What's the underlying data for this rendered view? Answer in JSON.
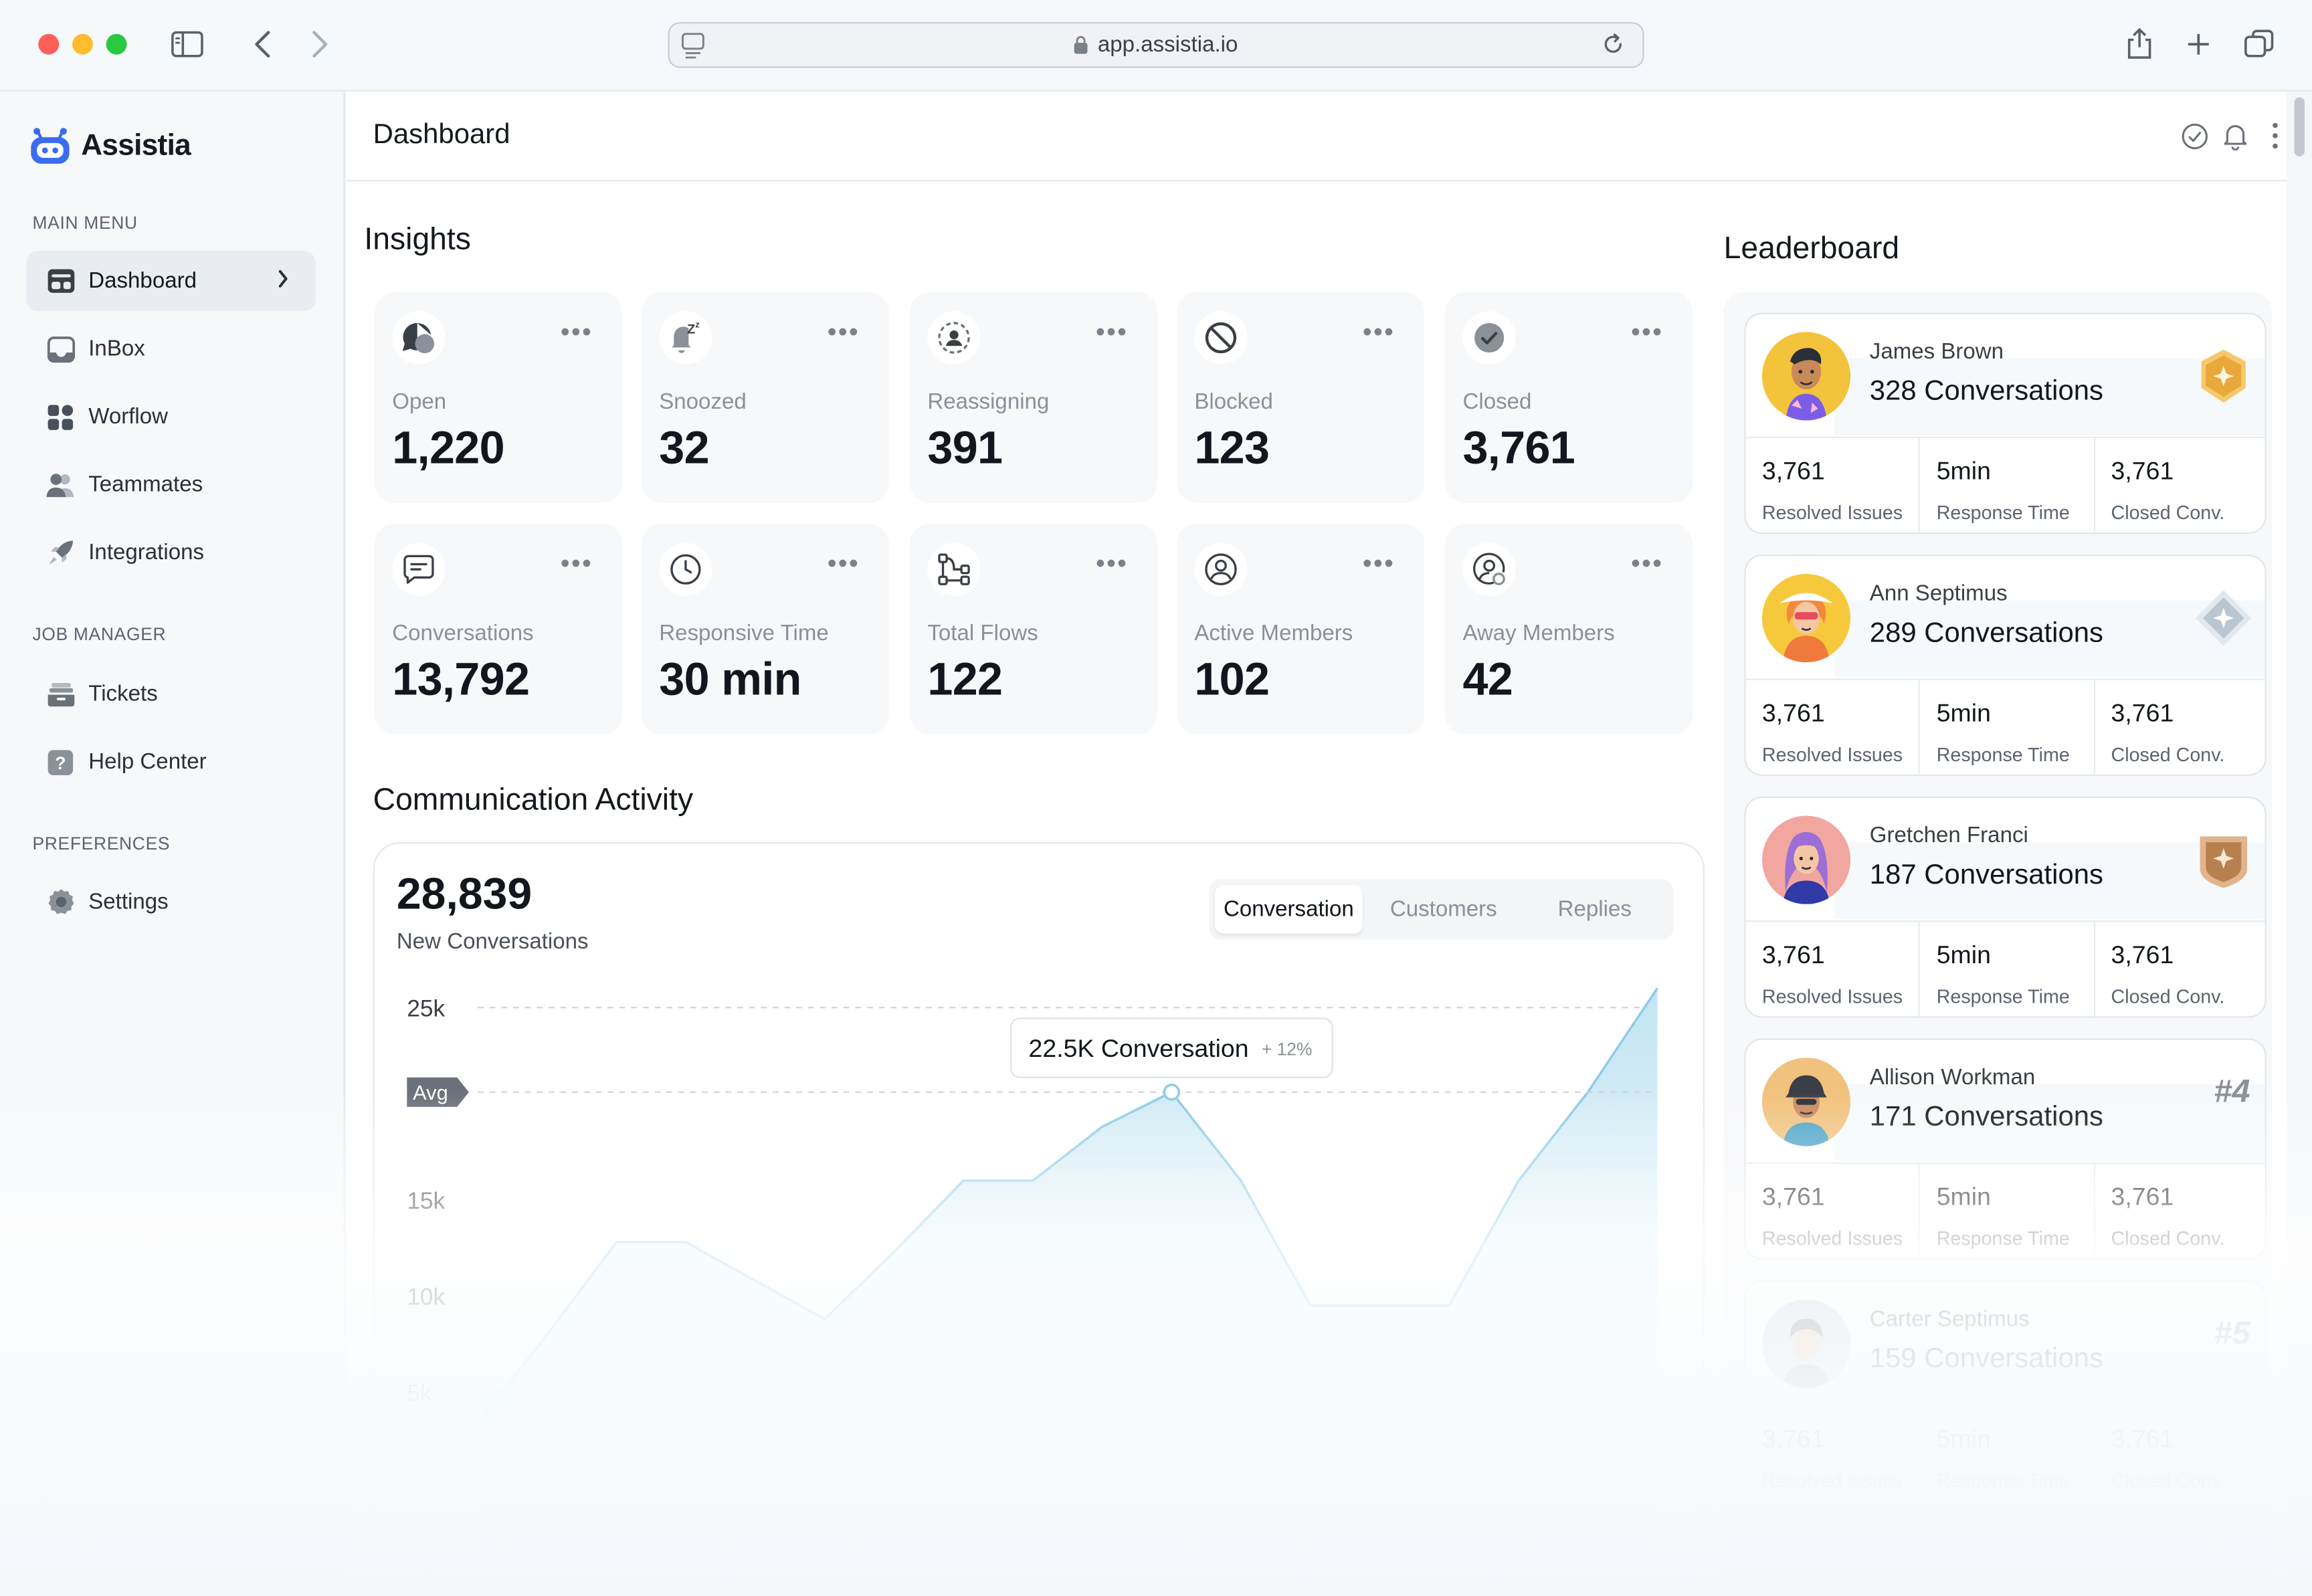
{
  "browser": {
    "url": "app.assistia.io"
  },
  "brand": {
    "name": "Assistia",
    "color": "#3b6cf0"
  },
  "sidebar": {
    "sections": [
      {
        "title": "MAIN MENU"
      },
      {
        "title": "JOB MANAGER"
      },
      {
        "title": "PREFERENCES"
      }
    ],
    "items": [
      {
        "label": "Dashboard",
        "icon": "dashboard-icon",
        "active": true
      },
      {
        "label": "InBox",
        "icon": "inbox-icon"
      },
      {
        "label": "Worflow",
        "icon": "workflow-icon"
      },
      {
        "label": "Teammates",
        "icon": "teammates-icon"
      },
      {
        "label": "Integrations",
        "icon": "rocket-icon"
      },
      {
        "label": "Tickets",
        "icon": "tickets-icon"
      },
      {
        "label": "Help Center",
        "icon": "help-icon"
      },
      {
        "label": "Settings",
        "icon": "settings-icon"
      }
    ]
  },
  "header": {
    "title": "Dashboard"
  },
  "insights": {
    "title": "Insights",
    "cards": [
      {
        "label": "Open",
        "value": "1,220",
        "icon": "open-chat-icon"
      },
      {
        "label": "Snoozed",
        "value": "32",
        "icon": "snooze-bell-icon"
      },
      {
        "label": "Reassigning",
        "value": "391",
        "icon": "reassign-icon"
      },
      {
        "label": "Blocked",
        "value": "123",
        "icon": "blocked-icon"
      },
      {
        "label": "Closed",
        "value": "3,761",
        "icon": "check-circle-icon"
      },
      {
        "label": "Conversations",
        "value": "13,792",
        "icon": "message-icon"
      },
      {
        "label": "Responsive Time",
        "value": "30 min",
        "icon": "clock-icon"
      },
      {
        "label": "Total Flows",
        "value": "122",
        "icon": "flows-icon"
      },
      {
        "label": "Active Members",
        "value": "102",
        "icon": "user-circle-icon"
      },
      {
        "label": "Away Members",
        "value": "42",
        "icon": "away-user-icon"
      }
    ]
  },
  "activity": {
    "title": "Communication Activity",
    "total": "28,839",
    "subtitle": "New Conversations",
    "tabs": [
      {
        "label": "Conversation",
        "active": true
      },
      {
        "label": "Customers"
      },
      {
        "label": "Replies"
      }
    ],
    "tooltip": {
      "value": "22.5K Conversation",
      "delta": "+ 12%"
    },
    "avg_label": "Avg"
  },
  "chart_data": {
    "type": "area",
    "y_ticks": [
      "25k",
      "15k",
      "10k",
      "5k"
    ],
    "ylim": [
      0,
      26000
    ],
    "avg": 20600,
    "x": [
      0,
      1,
      2,
      3,
      4,
      5,
      6,
      7,
      8,
      9,
      10,
      11,
      12,
      13,
      14,
      15,
      16,
      17
    ],
    "values": [
      3400,
      8000,
      12800,
      12800,
      10800,
      8800,
      12300,
      16000,
      16000,
      18800,
      20600,
      16000,
      9500,
      9500,
      9500,
      16000,
      20600,
      26000
    ],
    "highlight_index": 10,
    "color": "#8ecbe6"
  },
  "leaderboard": {
    "title": "Leaderboard",
    "stat_labels": [
      "Resolved Issues",
      "Response Time",
      "Closed Conv."
    ],
    "entries": [
      {
        "name": "James Brown",
        "conversations": "328 Conversations",
        "stats": [
          "3,761",
          "5min",
          "3,761"
        ],
        "badge": "gold-badge-icon",
        "avatar_color": "#f4c33c"
      },
      {
        "name": "Ann Septimus",
        "conversations": "289 Conversations",
        "stats": [
          "3,761",
          "5min",
          "3,761"
        ],
        "badge": "silver-badge-icon",
        "avatar_color": "#f6c93d"
      },
      {
        "name": "Gretchen Franci",
        "conversations": "187 Conversations",
        "stats": [
          "3,761",
          "5min",
          "3,761"
        ],
        "badge": "bronze-badge-icon",
        "avatar_color": "#f2a6a0"
      },
      {
        "name": "Allison Workman",
        "conversations": "171 Conversations",
        "stats": [
          "3,761",
          "5min",
          "3,761"
        ],
        "rank": "#4",
        "avatar_color": "#f1c27d"
      },
      {
        "name": "Carter Septimus",
        "conversations": "159 Conversations",
        "stats": [
          "3,761",
          "5min",
          "3,761"
        ],
        "rank": "#5",
        "avatar_color": "#b7c9d6"
      }
    ]
  }
}
